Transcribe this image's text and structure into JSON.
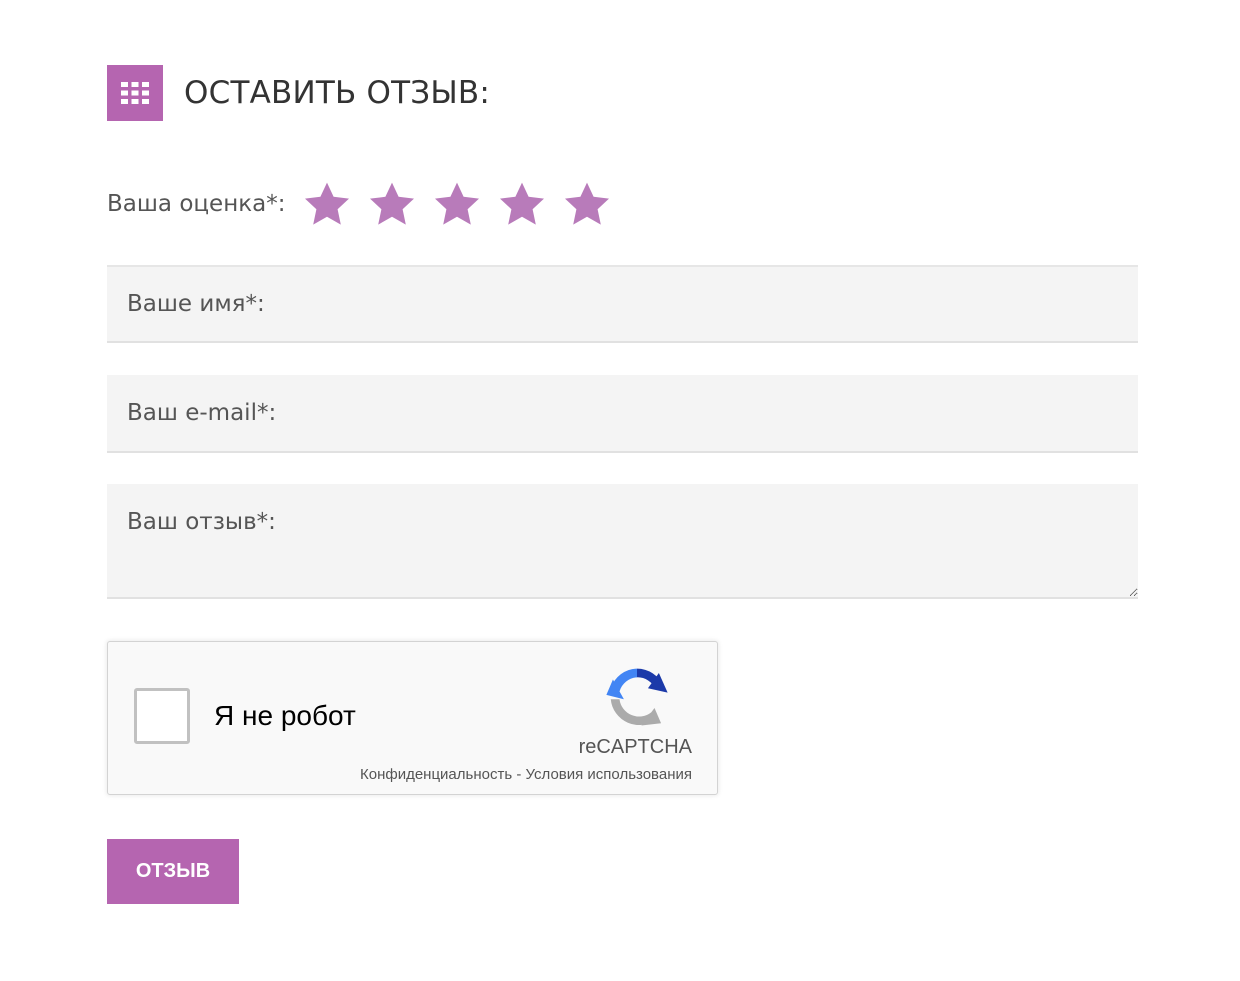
{
  "header": {
    "icon": "grid-icon",
    "title": "ОСТАВИТЬ ОТЗЫВ:"
  },
  "rating": {
    "label": "Ваша оценка*:",
    "max_stars": 5,
    "star_color": "#b565b0"
  },
  "form": {
    "name_placeholder": "Ваше имя*:",
    "email_placeholder": "Ваш e-mail*:",
    "review_placeholder": "Ваш отзыв*:"
  },
  "recaptcha": {
    "checkbox_label": "Я не робот",
    "brand": "reCAPTCHA",
    "privacy_link": "Конфиденциальность",
    "separator": " - ",
    "terms_link": "Условия использования"
  },
  "submit": {
    "label": "ОТЗЫВ"
  },
  "colors": {
    "accent": "#b565b0",
    "field_bg": "#f4f4f4"
  }
}
